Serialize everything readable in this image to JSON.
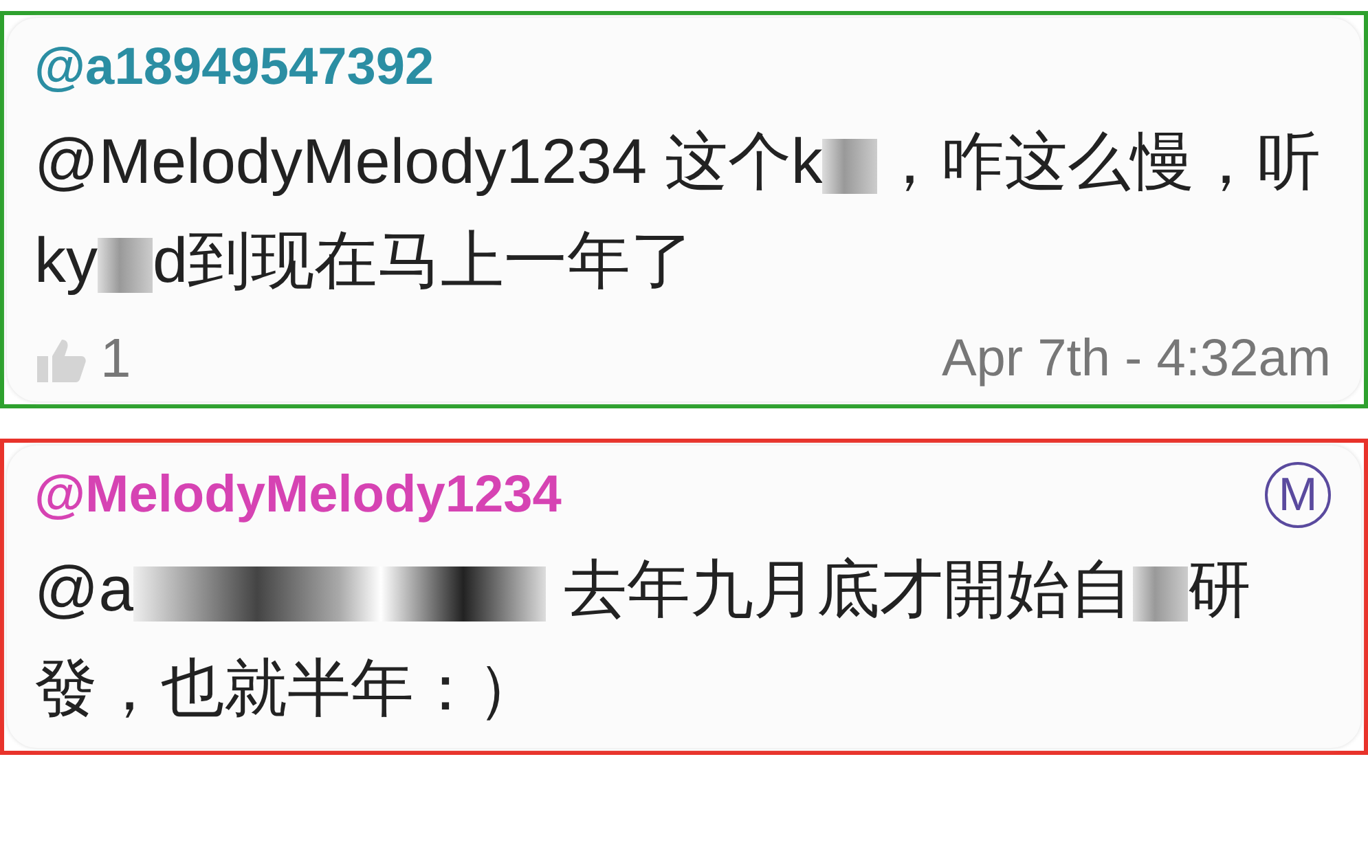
{
  "comments": [
    {
      "color": "#2ea12e",
      "author": {
        "name": "@a18949547392",
        "color": "#2b8ea3"
      },
      "body": [
        {
          "kind": "text",
          "text": "@MelodyMelody1234 这个k"
        },
        {
          "kind": "redacted"
        },
        {
          "kind": "text",
          "text": "，咋这么慢，听ky"
        },
        {
          "kind": "redacted"
        },
        {
          "kind": "text",
          "text": "d到现在马上一年了"
        }
      ],
      "likes": "1",
      "time": "Apr 7th - 4:32am"
    },
    {
      "color": "#e8332b",
      "author": {
        "name": "@MelodyMelody1234",
        "color": "#d643b3"
      },
      "badge": "M",
      "body": [
        {
          "kind": "text",
          "text": "@a"
        },
        {
          "kind": "redacted_long"
        },
        {
          "kind": "text",
          "text": " 去年九月底才開始自"
        },
        {
          "kind": "redacted"
        },
        {
          "kind": "text",
          "text": "研發，也就半年：）"
        }
      ]
    }
  ]
}
